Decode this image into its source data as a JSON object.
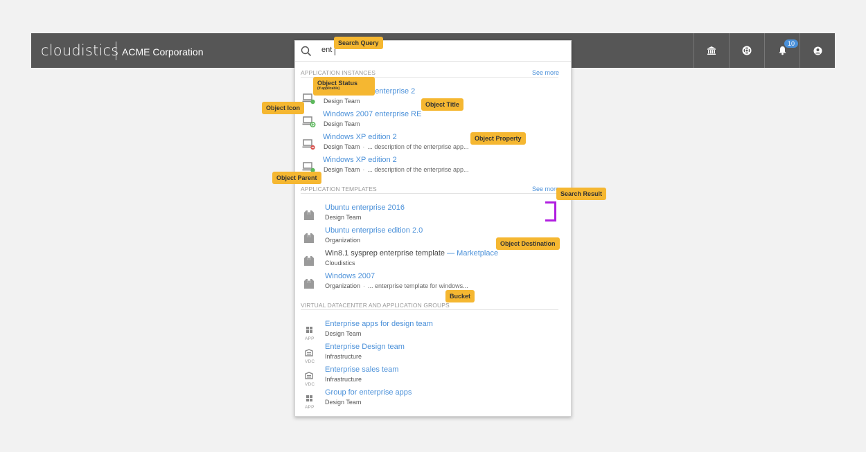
{
  "header": {
    "brand": "cloudistics",
    "org": "ACME Corporation",
    "notification_count": "10",
    "icons": [
      "bank-icon",
      "lifebuoy-icon",
      "bell-icon",
      "user-icon"
    ]
  },
  "search": {
    "query": "ent",
    "placeholder": ""
  },
  "sections": {
    "instances": {
      "title": "APPLICATION INSTANCES",
      "see_more": "See more",
      "items": [
        {
          "title": "Windows 2007 enterprise 2",
          "parent": "Design Team",
          "status": "running",
          "status_color": "#5cb85c"
        },
        {
          "title": "Windows 2007 enterprise RE",
          "parent": "Design Team",
          "status": "adding",
          "status_color": "#5cb85c"
        },
        {
          "title": "Windows XP edition 2",
          "parent": "Design Team",
          "property": "... description of the enterprise app...",
          "status": "stopped",
          "status_color": "#d9534f"
        },
        {
          "title": "Windows XP edition 2",
          "parent": "Design Team",
          "property": "... description of the enterprise app...",
          "status": "running",
          "status_color": "#5cb85c"
        }
      ]
    },
    "templates": {
      "title": "APPLICATION TEMPLATES",
      "see_more": "See more",
      "items": [
        {
          "title": "Ubuntu enterprise 2016",
          "parent": "Design Team"
        },
        {
          "title": "Ubuntu enterprise edition 2.0",
          "parent": "Organization"
        },
        {
          "title": "Win8.1 sysprep enterprise template",
          "destination": "— Marketplace",
          "parent": "Cloudistics"
        },
        {
          "title": "Windows 2007",
          "parent": "Organization",
          "property": "... enterprise template for windows..."
        }
      ]
    },
    "groups": {
      "title": "VIRTUAL DATACENTER AND APPLICATION GROUPS",
      "items": [
        {
          "title": "Enterprise apps for design team",
          "parent": "Design Team",
          "tag": "APP"
        },
        {
          "title": "Enterprise Design team",
          "parent": "Infrastructure",
          "tag": "VDC"
        },
        {
          "title": "Enterprise sales team",
          "parent": "Infrastructure",
          "tag": "VDC"
        },
        {
          "title": "Group for enterprise apps",
          "parent": "Design Team",
          "tag": "APP"
        }
      ]
    }
  },
  "annotations": {
    "search_query": "Search Query",
    "object_status": "Object Status",
    "object_status_sub": "(if applicable)",
    "object_icon": "Object Icon",
    "object_title": "Object Title",
    "object_property": "Object Property",
    "object_parent": "Object Parent",
    "search_result": "Search Result",
    "object_destination": "Object Destination",
    "bucket": "Bucket"
  },
  "colors": {
    "topbar": "#565656",
    "link": "#4a90d9",
    "annotation": "#f5b731",
    "bracket": "#b01de0",
    "badge": "#4a90d9"
  }
}
